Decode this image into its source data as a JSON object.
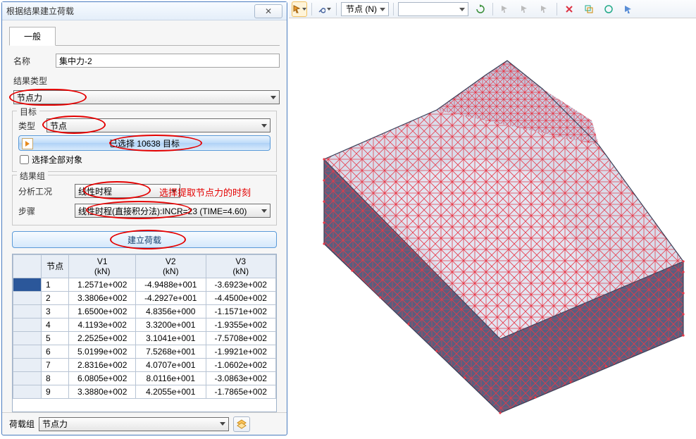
{
  "dialog": {
    "title": "根据结果建立荷载",
    "close": "✕",
    "tab_general": "一般",
    "name_lbl": "名称",
    "name_value": "集中力-2",
    "result_type_lbl": "结果类型",
    "result_type_value": "节点力",
    "target_section": "目标",
    "type_lbl": "类型",
    "type_value": "节点",
    "selected_text": "已选择 10638 目标",
    "select_all_lbl": "选择全部对象",
    "result_group_section": "结果组",
    "analysis_lbl": "分析工况",
    "analysis_value": "线性时程",
    "step_lbl": "步骤",
    "step_value": "线性时程(直接积分法):INCR=23 (TIME=4.60)",
    "annotation": "选择提取节点力的时刻",
    "create_btn": "建立荷载",
    "table_headers": {
      "node": "节点",
      "v1": "V1",
      "v2": "V2",
      "v3": "V3",
      "unit": "(kN)"
    },
    "rows": [
      {
        "n": "1",
        "v1": "1.2571e+002",
        "v2": "-4.9488e+001",
        "v3": "-3.6923e+002"
      },
      {
        "n": "2",
        "v1": "3.3806e+002",
        "v2": "-4.2927e+001",
        "v3": "-4.4500e+002"
      },
      {
        "n": "3",
        "v1": "1.6500e+002",
        "v2": "4.8356e+000",
        "v3": "-1.1571e+002"
      },
      {
        "n": "4",
        "v1": "4.1193e+002",
        "v2": "3.3200e+001",
        "v3": "-1.9355e+002"
      },
      {
        "n": "5",
        "v1": "2.2525e+002",
        "v2": "3.1041e+001",
        "v3": "-7.5708e+002"
      },
      {
        "n": "6",
        "v1": "5.0199e+002",
        "v2": "7.5268e+001",
        "v3": "-1.9921e+002"
      },
      {
        "n": "7",
        "v1": "2.8316e+002",
        "v2": "4.0707e+001",
        "v3": "-1.0602e+002"
      },
      {
        "n": "8",
        "v1": "6.0805e+002",
        "v2": "8.0116e+001",
        "v3": "-3.0863e+002"
      },
      {
        "n": "9",
        "v1": "3.3880e+002",
        "v2": "4.2055e+001",
        "v3": "-1.7865e+002"
      }
    ],
    "footer_lbl": "荷载组",
    "footer_value": "节点力"
  },
  "toolbar": {
    "mode": "节点 (N)"
  }
}
